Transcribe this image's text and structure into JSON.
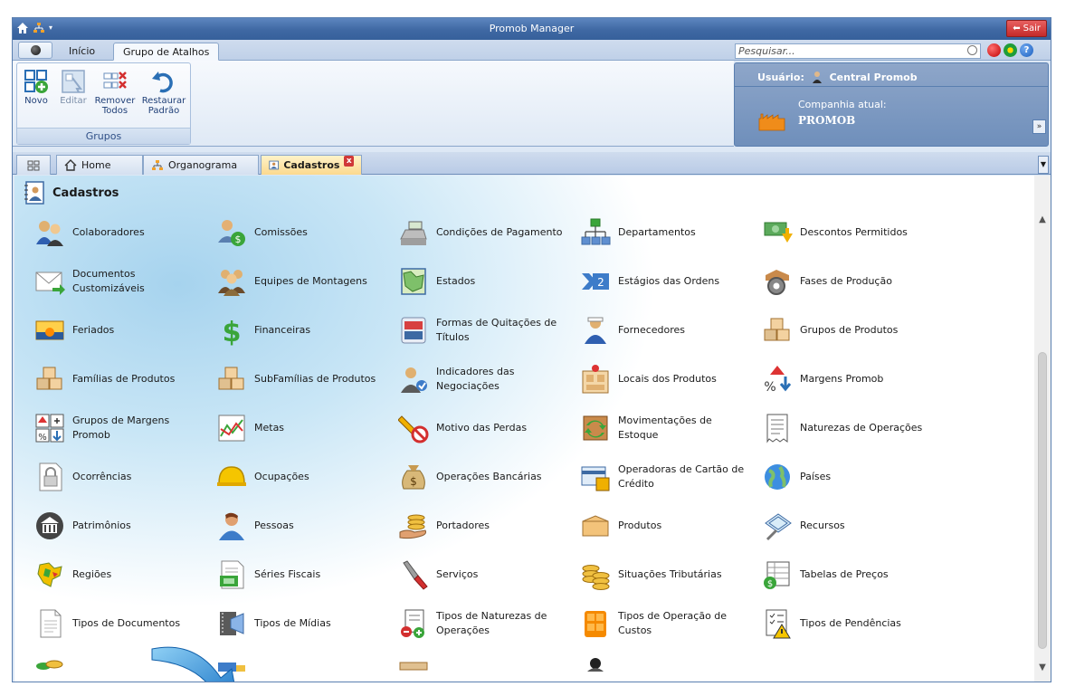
{
  "window": {
    "title": "Promob Manager",
    "exit_label": "Sair"
  },
  "ribbon_tabs": [
    {
      "label": "Início"
    },
    {
      "label": "Grupo de Atalhos",
      "active": true
    }
  ],
  "search": {
    "placeholder": "Pesquisar..."
  },
  "ribbon": {
    "group_label": "Grupos",
    "buttons": [
      {
        "label": "Novo",
        "enabled": true
      },
      {
        "label": "Editar",
        "enabled": false
      },
      {
        "label": "Remover Todos",
        "enabled": true
      },
      {
        "label": "Restaurar Padrão",
        "enabled": true
      }
    ]
  },
  "user_panel": {
    "user_label": "Usuário:",
    "user_name": "Central Promob",
    "company_label": "Companhia atual:",
    "company_name": "PROMOB"
  },
  "doc_tabs": [
    {
      "label": "Home",
      "icon": "home-icon"
    },
    {
      "label": "Organograma",
      "icon": "org-chart-icon"
    },
    {
      "label": "Cadastros",
      "icon": "registry-icon",
      "active": true,
      "close": "x"
    }
  ],
  "content": {
    "title": "Cadastros",
    "items": [
      {
        "label": "Colaboradores",
        "icon": "people-icon"
      },
      {
        "label": "Comissões",
        "icon": "commission-icon"
      },
      {
        "label": "Condições de Pagamento",
        "icon": "cash-register-icon"
      },
      {
        "label": "Departamentos",
        "icon": "org-chart-icon"
      },
      {
        "label": "Descontos Permitidos",
        "icon": "discount-icon"
      },
      {
        "label": "Documentos Customizáveis",
        "icon": "envelope-icon"
      },
      {
        "label": "Equipes de Montagens",
        "icon": "team-icon"
      },
      {
        "label": "Estados",
        "icon": "map-icon"
      },
      {
        "label": "Estágios das Ordens",
        "icon": "stages-icon"
      },
      {
        "label": "Fases de Produção",
        "icon": "gear-box-icon"
      },
      {
        "label": "Feriados",
        "icon": "sunset-icon"
      },
      {
        "label": "Financeiras",
        "icon": "dollar-icon"
      },
      {
        "label": "Formas de Quitações de Títulos",
        "icon": "credit-card-icon"
      },
      {
        "label": "Fornecedores",
        "icon": "supplier-icon"
      },
      {
        "label": "Grupos de Produtos",
        "icon": "boxes-icon"
      },
      {
        "label": "Famílias de Produtos",
        "icon": "boxes-icon"
      },
      {
        "label": "SubFamílias de Produtos",
        "icon": "boxes-icon"
      },
      {
        "label": "Indicadores das Negociações",
        "icon": "negotiation-icon"
      },
      {
        "label": "Locais dos Produtos",
        "icon": "warehouse-icon"
      },
      {
        "label": "Margens Promob",
        "icon": "margin-icon"
      },
      {
        "label": "Grupos de Margens Promob",
        "icon": "margin-grid-icon"
      },
      {
        "label": "Metas",
        "icon": "goals-chart-icon"
      },
      {
        "label": "Motivo das Perdas",
        "icon": "prohibited-pencil-icon"
      },
      {
        "label": "Movimentações de Estoque",
        "icon": "stock-move-icon"
      },
      {
        "label": "Naturezas de Operações",
        "icon": "receipt-icon"
      },
      {
        "label": "Ocorrências",
        "icon": "lock-doc-icon"
      },
      {
        "label": "Ocupações",
        "icon": "helmet-icon"
      },
      {
        "label": "Operações Bancárias",
        "icon": "money-bag-icon"
      },
      {
        "label": "Operadoras de Cartão de Crédito",
        "icon": "card-terminal-icon"
      },
      {
        "label": "Países",
        "icon": "globe-icon"
      },
      {
        "label": "Patrimônios",
        "icon": "bank-icon"
      },
      {
        "label": "Pessoas",
        "icon": "person-icon"
      },
      {
        "label": "Portadores",
        "icon": "coins-hand-icon"
      },
      {
        "label": "Produtos",
        "icon": "box-icon"
      },
      {
        "label": "Recursos",
        "icon": "tools-icon"
      },
      {
        "label": "Regiões",
        "icon": "regions-map-icon"
      },
      {
        "label": "Séries Fiscais",
        "icon": "fiscal-doc-icon"
      },
      {
        "label": "Serviços",
        "icon": "screwdriver-icon"
      },
      {
        "label": "Situações Tributárias",
        "icon": "coin-stack-icon"
      },
      {
        "label": "Tabelas de Preços",
        "icon": "price-table-icon"
      },
      {
        "label": "Tipos de Documentos",
        "icon": "document-icon"
      },
      {
        "label": "Tipos de Mídias",
        "icon": "media-icon"
      },
      {
        "label": "Tipos de Naturezas de Operações",
        "icon": "receipt-add-icon"
      },
      {
        "label": "Tipos de Operação de Custos",
        "icon": "calculator-icon"
      },
      {
        "label": "Tipos de Pendências",
        "icon": "warning-list-icon"
      },
      {
        "label": "",
        "icon": "coins-icon"
      },
      {
        "label": "",
        "icon": "truck-icon"
      },
      {
        "label": "",
        "icon": "ruler-icon"
      },
      {
        "label": "",
        "icon": "user-icon"
      }
    ]
  },
  "colors": {
    "title_bar": "#3f68a3",
    "exit_button": "#c42a2a",
    "accent_arrow": "#1f8fd8",
    "active_tab": "#fbd98e"
  }
}
